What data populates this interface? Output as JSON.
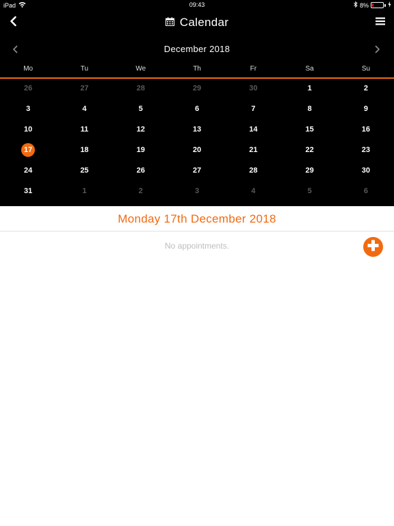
{
  "status_bar": {
    "device": "iPad",
    "time": "09:43",
    "battery": "8%",
    "battery_level": 0.08
  },
  "header": {
    "title": "Calendar",
    "back_icon": "chevron-left-icon",
    "menu_icon": "hamburger-menu-icon",
    "title_icon": "calendar-icon"
  },
  "calendar": {
    "month": "December 2018",
    "weekdays": [
      "Mo",
      "Tu",
      "We",
      "Th",
      "Fr",
      "Sa",
      "Su"
    ],
    "days": [
      {
        "n": "26",
        "muted": true
      },
      {
        "n": "27",
        "muted": true
      },
      {
        "n": "28",
        "muted": true
      },
      {
        "n": "29",
        "muted": true
      },
      {
        "n": "30",
        "muted": true
      },
      {
        "n": "1"
      },
      {
        "n": "2"
      },
      {
        "n": "3"
      },
      {
        "n": "4"
      },
      {
        "n": "5"
      },
      {
        "n": "6"
      },
      {
        "n": "7"
      },
      {
        "n": "8"
      },
      {
        "n": "9"
      },
      {
        "n": "10"
      },
      {
        "n": "11"
      },
      {
        "n": "12"
      },
      {
        "n": "13"
      },
      {
        "n": "14"
      },
      {
        "n": "15"
      },
      {
        "n": "16"
      },
      {
        "n": "17",
        "selected": true
      },
      {
        "n": "18"
      },
      {
        "n": "19"
      },
      {
        "n": "20"
      },
      {
        "n": "21"
      },
      {
        "n": "22"
      },
      {
        "n": "23"
      },
      {
        "n": "24"
      },
      {
        "n": "25"
      },
      {
        "n": "26"
      },
      {
        "n": "27"
      },
      {
        "n": "28"
      },
      {
        "n": "29"
      },
      {
        "n": "30"
      },
      {
        "n": "31"
      },
      {
        "n": "1",
        "muted": true
      },
      {
        "n": "2",
        "muted": true
      },
      {
        "n": "3",
        "muted": true
      },
      {
        "n": "4",
        "muted": true
      },
      {
        "n": "5",
        "muted": true
      },
      {
        "n": "6",
        "muted": true
      }
    ]
  },
  "selected_date": "Monday 17th December 2018",
  "appointments": {
    "empty_text": "No appointments."
  },
  "colors": {
    "accent": "#f26a10",
    "background_dark": "#000000",
    "muted_day": "#585858"
  }
}
